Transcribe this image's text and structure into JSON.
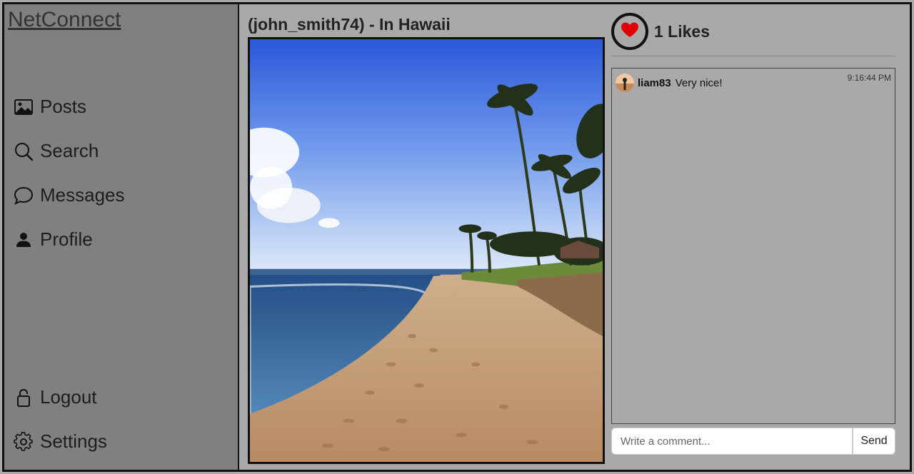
{
  "app": {
    "brand": "NetConnect"
  },
  "sidebar": {
    "items": [
      {
        "label": "Posts",
        "icon": "image-icon"
      },
      {
        "label": "Search",
        "icon": "search-icon"
      },
      {
        "label": "Messages",
        "icon": "chat-icon"
      },
      {
        "label": "Profile",
        "icon": "person-icon"
      }
    ],
    "bottom_items": [
      {
        "label": "Logout",
        "icon": "lock-icon"
      },
      {
        "label": "Settings",
        "icon": "gear-icon"
      }
    ]
  },
  "post": {
    "title": "(john_smith74) - In Hawaii",
    "image": "beach-palm-trees-photo",
    "likes_label": "1 Likes",
    "like_icon": "heart-icon",
    "heart_color": "#e00000"
  },
  "comments": [
    {
      "user": "liam83",
      "text": "Very nice!",
      "time": "9:16:44 PM"
    }
  ],
  "comment_form": {
    "placeholder": "Write a comment...",
    "send_label": "Send"
  }
}
